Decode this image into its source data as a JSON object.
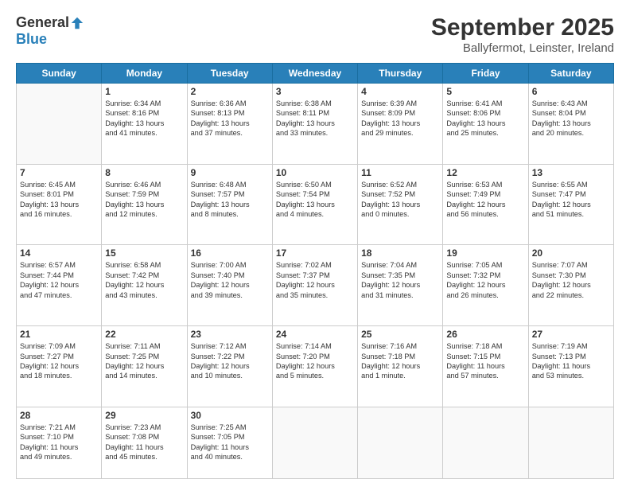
{
  "header": {
    "logo": {
      "general": "General",
      "blue": "Blue"
    },
    "title": "September 2025",
    "subtitle": "Ballyfermot, Leinster, Ireland"
  },
  "calendar": {
    "days_of_week": [
      "Sunday",
      "Monday",
      "Tuesday",
      "Wednesday",
      "Thursday",
      "Friday",
      "Saturday"
    ],
    "weeks": [
      [
        {
          "day": "",
          "text": ""
        },
        {
          "day": "1",
          "text": "Sunrise: 6:34 AM\nSunset: 8:16 PM\nDaylight: 13 hours\nand 41 minutes."
        },
        {
          "day": "2",
          "text": "Sunrise: 6:36 AM\nSunset: 8:13 PM\nDaylight: 13 hours\nand 37 minutes."
        },
        {
          "day": "3",
          "text": "Sunrise: 6:38 AM\nSunset: 8:11 PM\nDaylight: 13 hours\nand 33 minutes."
        },
        {
          "day": "4",
          "text": "Sunrise: 6:39 AM\nSunset: 8:09 PM\nDaylight: 13 hours\nand 29 minutes."
        },
        {
          "day": "5",
          "text": "Sunrise: 6:41 AM\nSunset: 8:06 PM\nDaylight: 13 hours\nand 25 minutes."
        },
        {
          "day": "6",
          "text": "Sunrise: 6:43 AM\nSunset: 8:04 PM\nDaylight: 13 hours\nand 20 minutes."
        }
      ],
      [
        {
          "day": "7",
          "text": "Sunrise: 6:45 AM\nSunset: 8:01 PM\nDaylight: 13 hours\nand 16 minutes."
        },
        {
          "day": "8",
          "text": "Sunrise: 6:46 AM\nSunset: 7:59 PM\nDaylight: 13 hours\nand 12 minutes."
        },
        {
          "day": "9",
          "text": "Sunrise: 6:48 AM\nSunset: 7:57 PM\nDaylight: 13 hours\nand 8 minutes."
        },
        {
          "day": "10",
          "text": "Sunrise: 6:50 AM\nSunset: 7:54 PM\nDaylight: 13 hours\nand 4 minutes."
        },
        {
          "day": "11",
          "text": "Sunrise: 6:52 AM\nSunset: 7:52 PM\nDaylight: 13 hours\nand 0 minutes."
        },
        {
          "day": "12",
          "text": "Sunrise: 6:53 AM\nSunset: 7:49 PM\nDaylight: 12 hours\nand 56 minutes."
        },
        {
          "day": "13",
          "text": "Sunrise: 6:55 AM\nSunset: 7:47 PM\nDaylight: 12 hours\nand 51 minutes."
        }
      ],
      [
        {
          "day": "14",
          "text": "Sunrise: 6:57 AM\nSunset: 7:44 PM\nDaylight: 12 hours\nand 47 minutes."
        },
        {
          "day": "15",
          "text": "Sunrise: 6:58 AM\nSunset: 7:42 PM\nDaylight: 12 hours\nand 43 minutes."
        },
        {
          "day": "16",
          "text": "Sunrise: 7:00 AM\nSunset: 7:40 PM\nDaylight: 12 hours\nand 39 minutes."
        },
        {
          "day": "17",
          "text": "Sunrise: 7:02 AM\nSunset: 7:37 PM\nDaylight: 12 hours\nand 35 minutes."
        },
        {
          "day": "18",
          "text": "Sunrise: 7:04 AM\nSunset: 7:35 PM\nDaylight: 12 hours\nand 31 minutes."
        },
        {
          "day": "19",
          "text": "Sunrise: 7:05 AM\nSunset: 7:32 PM\nDaylight: 12 hours\nand 26 minutes."
        },
        {
          "day": "20",
          "text": "Sunrise: 7:07 AM\nSunset: 7:30 PM\nDaylight: 12 hours\nand 22 minutes."
        }
      ],
      [
        {
          "day": "21",
          "text": "Sunrise: 7:09 AM\nSunset: 7:27 PM\nDaylight: 12 hours\nand 18 minutes."
        },
        {
          "day": "22",
          "text": "Sunrise: 7:11 AM\nSunset: 7:25 PM\nDaylight: 12 hours\nand 14 minutes."
        },
        {
          "day": "23",
          "text": "Sunrise: 7:12 AM\nSunset: 7:22 PM\nDaylight: 12 hours\nand 10 minutes."
        },
        {
          "day": "24",
          "text": "Sunrise: 7:14 AM\nSunset: 7:20 PM\nDaylight: 12 hours\nand 5 minutes."
        },
        {
          "day": "25",
          "text": "Sunrise: 7:16 AM\nSunset: 7:18 PM\nDaylight: 12 hours\nand 1 minute."
        },
        {
          "day": "26",
          "text": "Sunrise: 7:18 AM\nSunset: 7:15 PM\nDaylight: 11 hours\nand 57 minutes."
        },
        {
          "day": "27",
          "text": "Sunrise: 7:19 AM\nSunset: 7:13 PM\nDaylight: 11 hours\nand 53 minutes."
        }
      ],
      [
        {
          "day": "28",
          "text": "Sunrise: 7:21 AM\nSunset: 7:10 PM\nDaylight: 11 hours\nand 49 minutes."
        },
        {
          "day": "29",
          "text": "Sunrise: 7:23 AM\nSunset: 7:08 PM\nDaylight: 11 hours\nand 45 minutes."
        },
        {
          "day": "30",
          "text": "Sunrise: 7:25 AM\nSunset: 7:05 PM\nDaylight: 11 hours\nand 40 minutes."
        },
        {
          "day": "",
          "text": ""
        },
        {
          "day": "",
          "text": ""
        },
        {
          "day": "",
          "text": ""
        },
        {
          "day": "",
          "text": ""
        }
      ]
    ]
  }
}
